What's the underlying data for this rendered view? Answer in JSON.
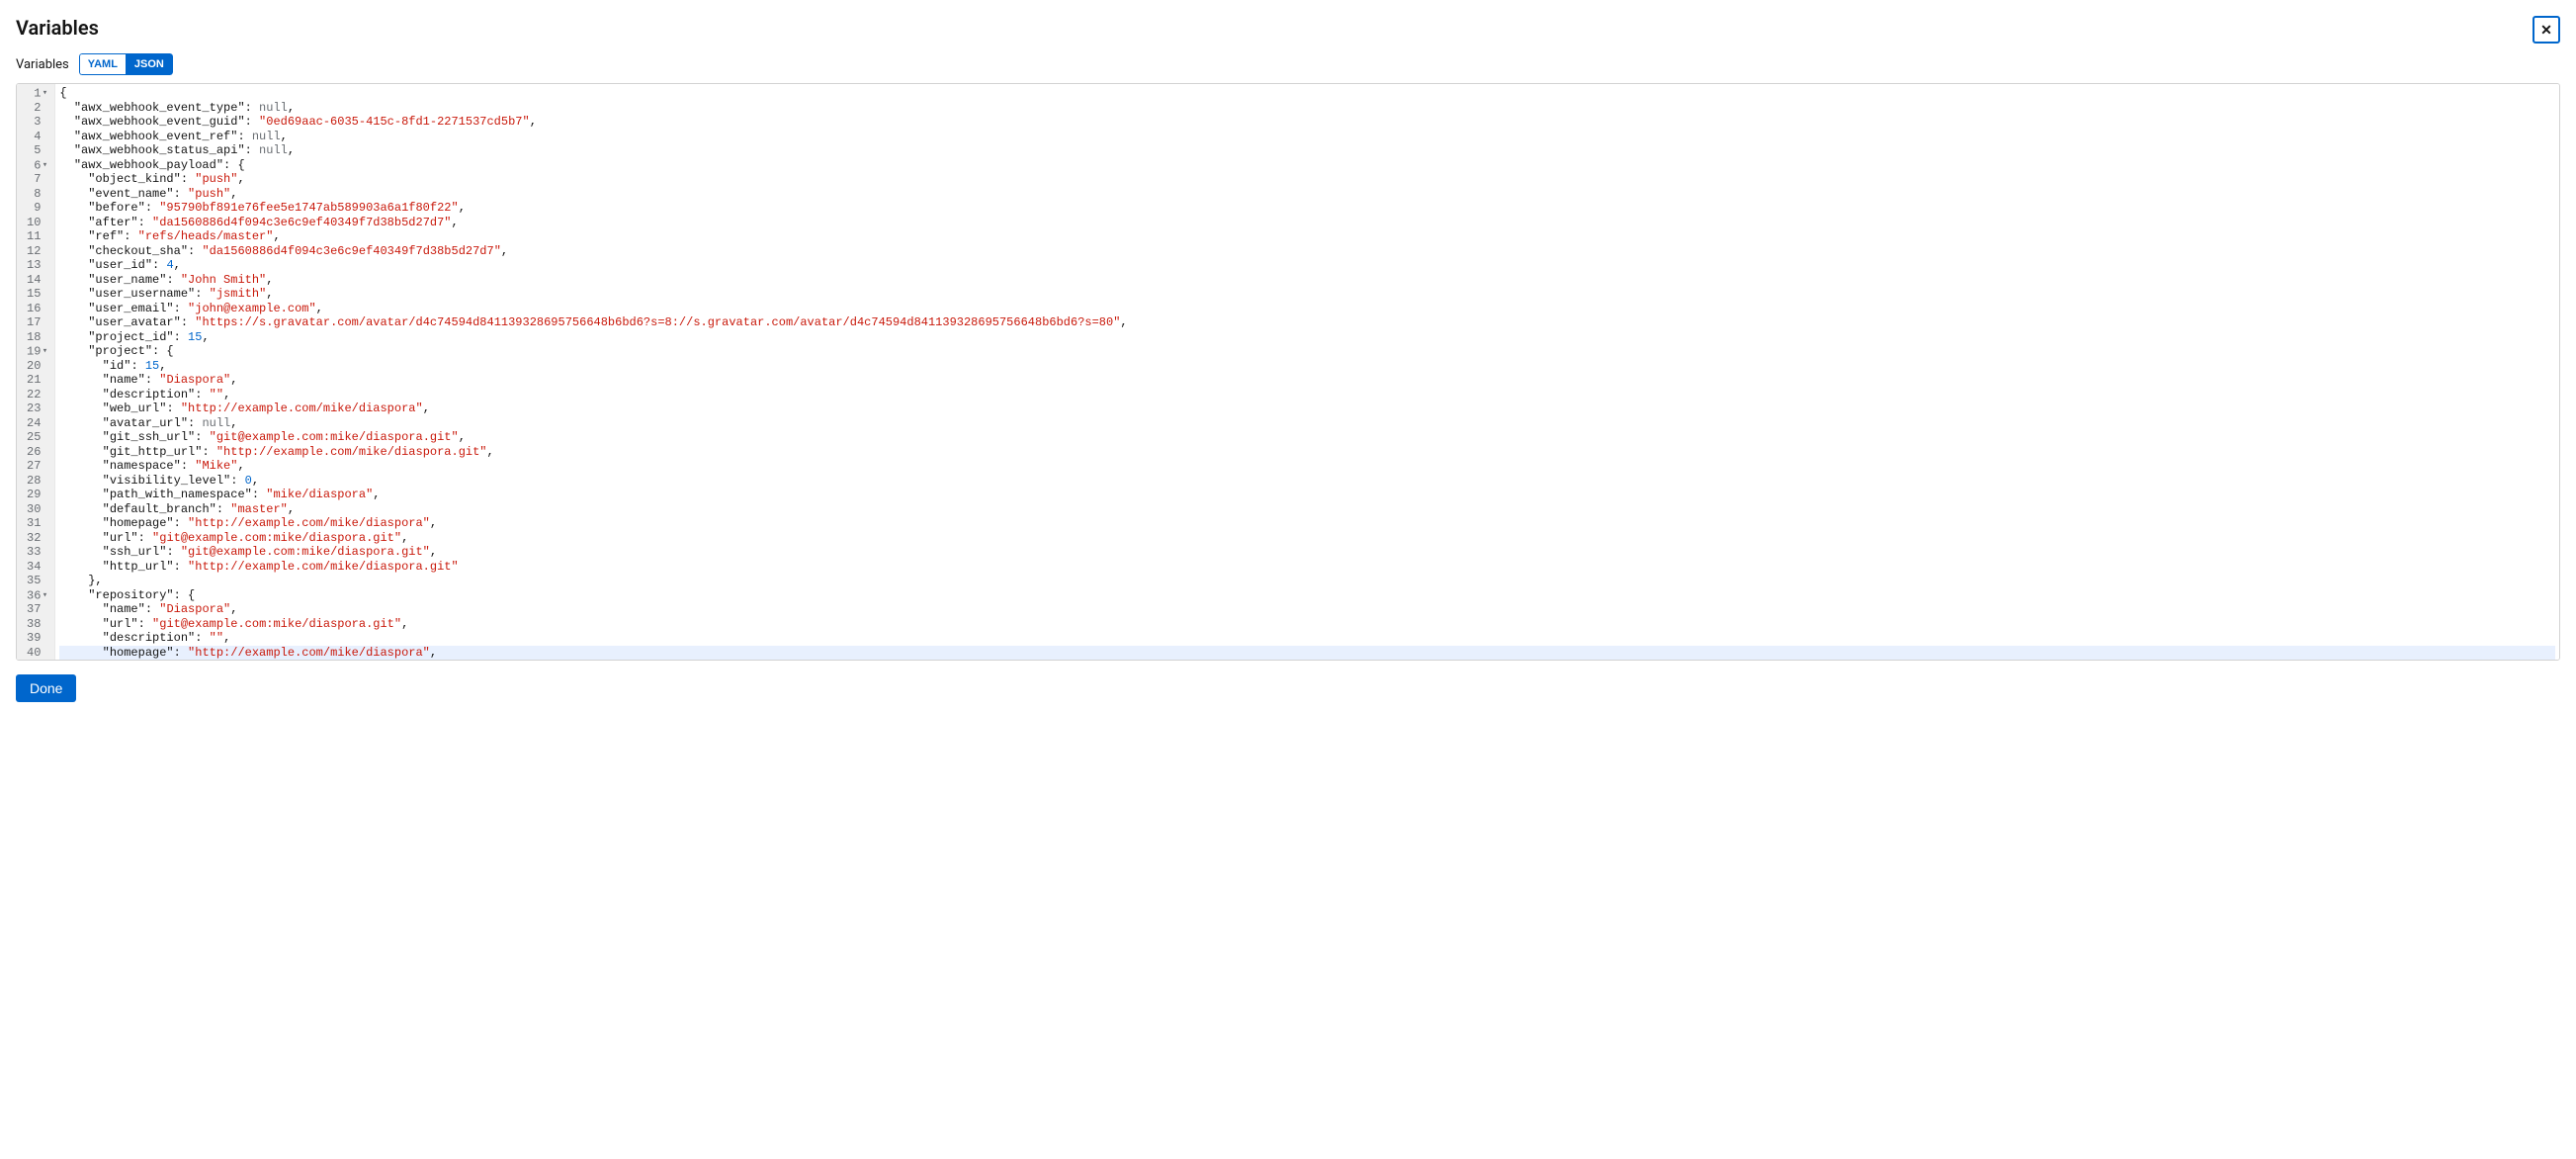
{
  "modal": {
    "title": "Variables",
    "close_label": "✕"
  },
  "toolbar": {
    "label": "Variables",
    "yaml_label": "YAML",
    "json_label": "JSON",
    "active": "JSON"
  },
  "footer": {
    "done_label": "Done"
  },
  "code_lines": [
    {
      "num": 1,
      "fold": true,
      "indent": 0,
      "tokens": [
        {
          "t": "p",
          "v": "{"
        }
      ]
    },
    {
      "num": 2,
      "fold": false,
      "indent": 1,
      "tokens": [
        {
          "t": "k",
          "v": "\"awx_webhook_event_type\""
        },
        {
          "t": "p",
          "v": ": "
        },
        {
          "t": "nl",
          "v": "null"
        },
        {
          "t": "p",
          "v": ","
        }
      ]
    },
    {
      "num": 3,
      "fold": false,
      "indent": 1,
      "tokens": [
        {
          "t": "k",
          "v": "\"awx_webhook_event_guid\""
        },
        {
          "t": "p",
          "v": ": "
        },
        {
          "t": "s",
          "v": "\"0ed69aac-6035-415c-8fd1-2271537cd5b7\""
        },
        {
          "t": "p",
          "v": ","
        }
      ]
    },
    {
      "num": 4,
      "fold": false,
      "indent": 1,
      "tokens": [
        {
          "t": "k",
          "v": "\"awx_webhook_event_ref\""
        },
        {
          "t": "p",
          "v": ": "
        },
        {
          "t": "nl",
          "v": "null"
        },
        {
          "t": "p",
          "v": ","
        }
      ]
    },
    {
      "num": 5,
      "fold": false,
      "indent": 1,
      "tokens": [
        {
          "t": "k",
          "v": "\"awx_webhook_status_api\""
        },
        {
          "t": "p",
          "v": ": "
        },
        {
          "t": "nl",
          "v": "null"
        },
        {
          "t": "p",
          "v": ","
        }
      ]
    },
    {
      "num": 6,
      "fold": true,
      "indent": 1,
      "tokens": [
        {
          "t": "k",
          "v": "\"awx_webhook_payload\""
        },
        {
          "t": "p",
          "v": ": {"
        }
      ]
    },
    {
      "num": 7,
      "fold": false,
      "indent": 2,
      "tokens": [
        {
          "t": "k",
          "v": "\"object_kind\""
        },
        {
          "t": "p",
          "v": ": "
        },
        {
          "t": "s",
          "v": "\"push\""
        },
        {
          "t": "p",
          "v": ","
        }
      ]
    },
    {
      "num": 8,
      "fold": false,
      "indent": 2,
      "tokens": [
        {
          "t": "k",
          "v": "\"event_name\""
        },
        {
          "t": "p",
          "v": ": "
        },
        {
          "t": "s",
          "v": "\"push\""
        },
        {
          "t": "p",
          "v": ","
        }
      ]
    },
    {
      "num": 9,
      "fold": false,
      "indent": 2,
      "tokens": [
        {
          "t": "k",
          "v": "\"before\""
        },
        {
          "t": "p",
          "v": ": "
        },
        {
          "t": "s",
          "v": "\"95790bf891e76fee5e1747ab589903a6a1f80f22\""
        },
        {
          "t": "p",
          "v": ","
        }
      ]
    },
    {
      "num": 10,
      "fold": false,
      "indent": 2,
      "tokens": [
        {
          "t": "k",
          "v": "\"after\""
        },
        {
          "t": "p",
          "v": ": "
        },
        {
          "t": "s",
          "v": "\"da1560886d4f094c3e6c9ef40349f7d38b5d27d7\""
        },
        {
          "t": "p",
          "v": ","
        }
      ]
    },
    {
      "num": 11,
      "fold": false,
      "indent": 2,
      "tokens": [
        {
          "t": "k",
          "v": "\"ref\""
        },
        {
          "t": "p",
          "v": ": "
        },
        {
          "t": "s",
          "v": "\"refs/heads/master\""
        },
        {
          "t": "p",
          "v": ","
        }
      ]
    },
    {
      "num": 12,
      "fold": false,
      "indent": 2,
      "tokens": [
        {
          "t": "k",
          "v": "\"checkout_sha\""
        },
        {
          "t": "p",
          "v": ": "
        },
        {
          "t": "s",
          "v": "\"da1560886d4f094c3e6c9ef40349f7d38b5d27d7\""
        },
        {
          "t": "p",
          "v": ","
        }
      ]
    },
    {
      "num": 13,
      "fold": false,
      "indent": 2,
      "tokens": [
        {
          "t": "k",
          "v": "\"user_id\""
        },
        {
          "t": "p",
          "v": ": "
        },
        {
          "t": "n",
          "v": "4"
        },
        {
          "t": "p",
          "v": ","
        }
      ]
    },
    {
      "num": 14,
      "fold": false,
      "indent": 2,
      "tokens": [
        {
          "t": "k",
          "v": "\"user_name\""
        },
        {
          "t": "p",
          "v": ": "
        },
        {
          "t": "s",
          "v": "\"John Smith\""
        },
        {
          "t": "p",
          "v": ","
        }
      ]
    },
    {
      "num": 15,
      "fold": false,
      "indent": 2,
      "tokens": [
        {
          "t": "k",
          "v": "\"user_username\""
        },
        {
          "t": "p",
          "v": ": "
        },
        {
          "t": "s",
          "v": "\"jsmith\""
        },
        {
          "t": "p",
          "v": ","
        }
      ]
    },
    {
      "num": 16,
      "fold": false,
      "indent": 2,
      "tokens": [
        {
          "t": "k",
          "v": "\"user_email\""
        },
        {
          "t": "p",
          "v": ": "
        },
        {
          "t": "s",
          "v": "\"john@example.com\""
        },
        {
          "t": "p",
          "v": ","
        }
      ]
    },
    {
      "num": 17,
      "fold": false,
      "indent": 2,
      "tokens": [
        {
          "t": "k",
          "v": "\"user_avatar\""
        },
        {
          "t": "p",
          "v": ": "
        },
        {
          "t": "s",
          "v": "\"https://s.gravatar.com/avatar/d4c74594d841139328695756648b6bd6?s=8://s.gravatar.com/avatar/d4c74594d841139328695756648b6bd6?s=80\""
        },
        {
          "t": "p",
          "v": ","
        }
      ]
    },
    {
      "num": 18,
      "fold": false,
      "indent": 2,
      "tokens": [
        {
          "t": "k",
          "v": "\"project_id\""
        },
        {
          "t": "p",
          "v": ": "
        },
        {
          "t": "n",
          "v": "15"
        },
        {
          "t": "p",
          "v": ","
        }
      ]
    },
    {
      "num": 19,
      "fold": true,
      "indent": 2,
      "tokens": [
        {
          "t": "k",
          "v": "\"project\""
        },
        {
          "t": "p",
          "v": ": {"
        }
      ]
    },
    {
      "num": 20,
      "fold": false,
      "indent": 3,
      "tokens": [
        {
          "t": "k",
          "v": "\"id\""
        },
        {
          "t": "p",
          "v": ": "
        },
        {
          "t": "n",
          "v": "15"
        },
        {
          "t": "p",
          "v": ","
        }
      ]
    },
    {
      "num": 21,
      "fold": false,
      "indent": 3,
      "tokens": [
        {
          "t": "k",
          "v": "\"name\""
        },
        {
          "t": "p",
          "v": ": "
        },
        {
          "t": "s",
          "v": "\"Diaspora\""
        },
        {
          "t": "p",
          "v": ","
        }
      ]
    },
    {
      "num": 22,
      "fold": false,
      "indent": 3,
      "tokens": [
        {
          "t": "k",
          "v": "\"description\""
        },
        {
          "t": "p",
          "v": ": "
        },
        {
          "t": "s",
          "v": "\"\""
        },
        {
          "t": "p",
          "v": ","
        }
      ]
    },
    {
      "num": 23,
      "fold": false,
      "indent": 3,
      "tokens": [
        {
          "t": "k",
          "v": "\"web_url\""
        },
        {
          "t": "p",
          "v": ": "
        },
        {
          "t": "s",
          "v": "\"http://example.com/mike/diaspora\""
        },
        {
          "t": "p",
          "v": ","
        }
      ]
    },
    {
      "num": 24,
      "fold": false,
      "indent": 3,
      "tokens": [
        {
          "t": "k",
          "v": "\"avatar_url\""
        },
        {
          "t": "p",
          "v": ": "
        },
        {
          "t": "nl",
          "v": "null"
        },
        {
          "t": "p",
          "v": ","
        }
      ]
    },
    {
      "num": 25,
      "fold": false,
      "indent": 3,
      "tokens": [
        {
          "t": "k",
          "v": "\"git_ssh_url\""
        },
        {
          "t": "p",
          "v": ": "
        },
        {
          "t": "s",
          "v": "\"git@example.com:mike/diaspora.git\""
        },
        {
          "t": "p",
          "v": ","
        }
      ]
    },
    {
      "num": 26,
      "fold": false,
      "indent": 3,
      "tokens": [
        {
          "t": "k",
          "v": "\"git_http_url\""
        },
        {
          "t": "p",
          "v": ": "
        },
        {
          "t": "s",
          "v": "\"http://example.com/mike/diaspora.git\""
        },
        {
          "t": "p",
          "v": ","
        }
      ]
    },
    {
      "num": 27,
      "fold": false,
      "indent": 3,
      "tokens": [
        {
          "t": "k",
          "v": "\"namespace\""
        },
        {
          "t": "p",
          "v": ": "
        },
        {
          "t": "s",
          "v": "\"Mike\""
        },
        {
          "t": "p",
          "v": ","
        }
      ]
    },
    {
      "num": 28,
      "fold": false,
      "indent": 3,
      "tokens": [
        {
          "t": "k",
          "v": "\"visibility_level\""
        },
        {
          "t": "p",
          "v": ": "
        },
        {
          "t": "n",
          "v": "0"
        },
        {
          "t": "p",
          "v": ","
        }
      ]
    },
    {
      "num": 29,
      "fold": false,
      "indent": 3,
      "tokens": [
        {
          "t": "k",
          "v": "\"path_with_namespace\""
        },
        {
          "t": "p",
          "v": ": "
        },
        {
          "t": "s",
          "v": "\"mike/diaspora\""
        },
        {
          "t": "p",
          "v": ","
        }
      ]
    },
    {
      "num": 30,
      "fold": false,
      "indent": 3,
      "tokens": [
        {
          "t": "k",
          "v": "\"default_branch\""
        },
        {
          "t": "p",
          "v": ": "
        },
        {
          "t": "s",
          "v": "\"master\""
        },
        {
          "t": "p",
          "v": ","
        }
      ]
    },
    {
      "num": 31,
      "fold": false,
      "indent": 3,
      "tokens": [
        {
          "t": "k",
          "v": "\"homepage\""
        },
        {
          "t": "p",
          "v": ": "
        },
        {
          "t": "s",
          "v": "\"http://example.com/mike/diaspora\""
        },
        {
          "t": "p",
          "v": ","
        }
      ]
    },
    {
      "num": 32,
      "fold": false,
      "indent": 3,
      "tokens": [
        {
          "t": "k",
          "v": "\"url\""
        },
        {
          "t": "p",
          "v": ": "
        },
        {
          "t": "s",
          "v": "\"git@example.com:mike/diaspora.git\""
        },
        {
          "t": "p",
          "v": ","
        }
      ]
    },
    {
      "num": 33,
      "fold": false,
      "indent": 3,
      "tokens": [
        {
          "t": "k",
          "v": "\"ssh_url\""
        },
        {
          "t": "p",
          "v": ": "
        },
        {
          "t": "s",
          "v": "\"git@example.com:mike/diaspora.git\""
        },
        {
          "t": "p",
          "v": ","
        }
      ]
    },
    {
      "num": 34,
      "fold": false,
      "indent": 3,
      "tokens": [
        {
          "t": "k",
          "v": "\"http_url\""
        },
        {
          "t": "p",
          "v": ": "
        },
        {
          "t": "s",
          "v": "\"http://example.com/mike/diaspora.git\""
        }
      ]
    },
    {
      "num": 35,
      "fold": false,
      "indent": 2,
      "tokens": [
        {
          "t": "p",
          "v": "},"
        }
      ]
    },
    {
      "num": 36,
      "fold": true,
      "indent": 2,
      "tokens": [
        {
          "t": "k",
          "v": "\"repository\""
        },
        {
          "t": "p",
          "v": ": {"
        }
      ]
    },
    {
      "num": 37,
      "fold": false,
      "indent": 3,
      "tokens": [
        {
          "t": "k",
          "v": "\"name\""
        },
        {
          "t": "p",
          "v": ": "
        },
        {
          "t": "s",
          "v": "\"Diaspora\""
        },
        {
          "t": "p",
          "v": ","
        }
      ]
    },
    {
      "num": 38,
      "fold": false,
      "indent": 3,
      "tokens": [
        {
          "t": "k",
          "v": "\"url\""
        },
        {
          "t": "p",
          "v": ": "
        },
        {
          "t": "s",
          "v": "\"git@example.com:mike/diaspora.git\""
        },
        {
          "t": "p",
          "v": ","
        }
      ]
    },
    {
      "num": 39,
      "fold": false,
      "indent": 3,
      "tokens": [
        {
          "t": "k",
          "v": "\"description\""
        },
        {
          "t": "p",
          "v": ": "
        },
        {
          "t": "s",
          "v": "\"\""
        },
        {
          "t": "p",
          "v": ","
        }
      ]
    },
    {
      "num": 40,
      "fold": false,
      "indent": 3,
      "tokens": [
        {
          "t": "k",
          "v": "\"homepage\""
        },
        {
          "t": "p",
          "v": ": "
        },
        {
          "t": "s",
          "v": "\"http://example.com/mike/diaspora\""
        },
        {
          "t": "p",
          "v": ","
        }
      ],
      "active": true
    }
  ]
}
